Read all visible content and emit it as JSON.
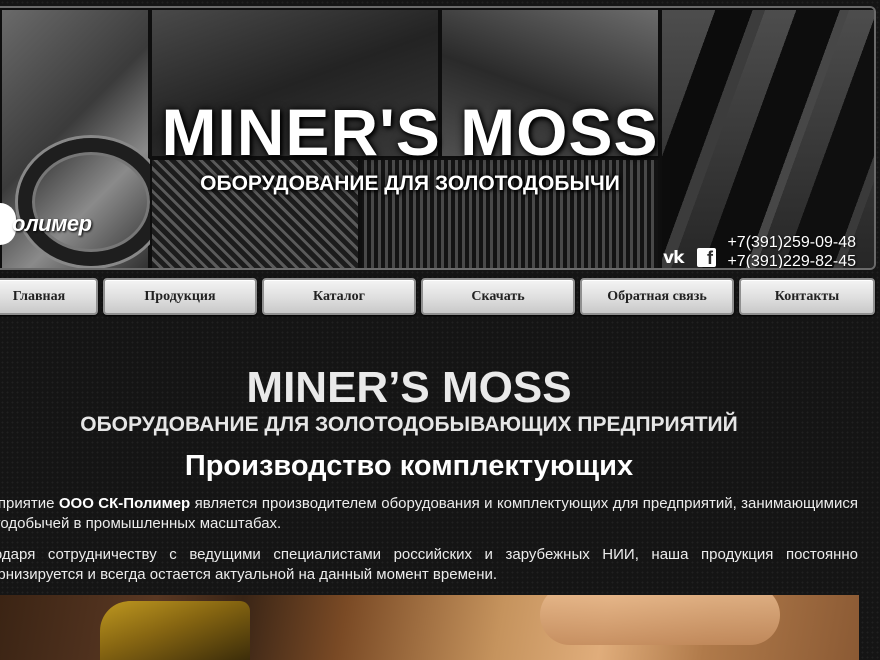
{
  "header": {
    "title": "MINER'S MOSS",
    "subtitle": "ОБОРУДОВАНИЕ ДЛЯ ЗОЛОТОДОБЫЧИ",
    "logo_text": "олимер",
    "phones": [
      "+7(391)259-09-48",
      "+7(391)229-82-45"
    ],
    "social": [
      "vk-icon",
      "facebook-icon"
    ],
    "vk_glyph": "vk",
    "fb_glyph": "f"
  },
  "nav": {
    "items": [
      "Главная",
      "Продукция",
      "Каталог",
      "Скачать",
      "Обратная связь",
      "Контакты"
    ]
  },
  "main": {
    "heading": "MINER’S MOSS",
    "subheading": "ОБОРУДОВАНИЕ ДЛЯ ЗОЛОТОДОБЫВАЮЩИХ ПРЕДПРИЯТИЙ",
    "section_title": "Производство комплектующих",
    "para1_a": "Предприятие ",
    "para1_company": "ООО СК-Полимер",
    "para1_b": " является производителем оборудования и комплектующих для предприятий, занимающимися золотодобычей в промышленных масштабах.",
    "para2": "Благодаря сотрудничеству с ведущими специалистами российских и зарубежных НИИ, наша продукция постоянно модернизируется и всегда остается актуальной на данный момент времени."
  }
}
